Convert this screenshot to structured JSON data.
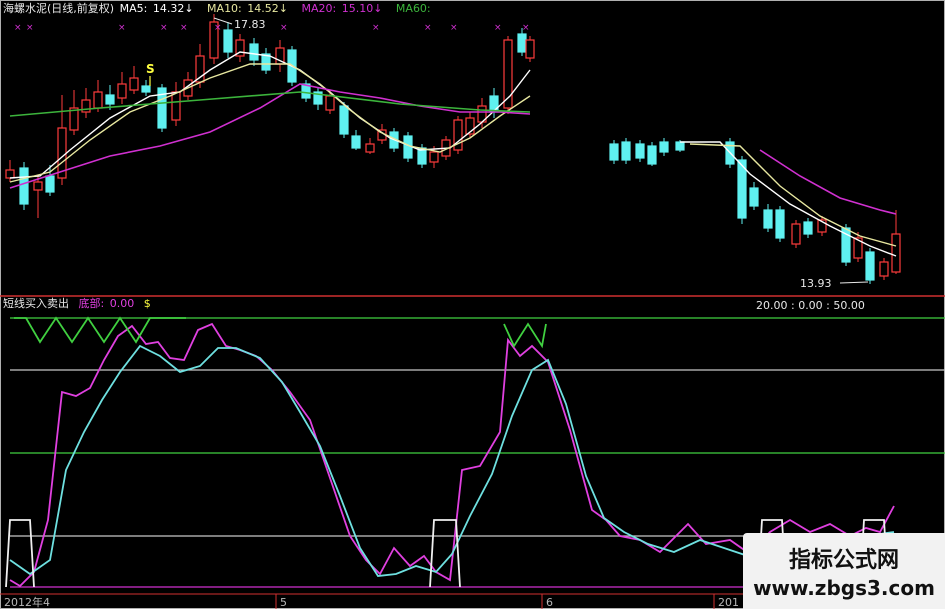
{
  "header": {
    "title": "海螺水泥(日线,前复权)",
    "ma5_label": "MA5:",
    "ma5_value": "14.32",
    "ma10_label": "MA10:",
    "ma10_value": "14.52",
    "ma20_label": "MA20:",
    "ma20_value": "15.10",
    "ma60_label": "MA60:",
    "arrow": "↓"
  },
  "annotations": {
    "high_price": "17.83",
    "low_price": "13.93",
    "signal_label": "S"
  },
  "indicator": {
    "title": "短线买入卖出",
    "bottom_label": "底部:",
    "bottom_value": "0.00",
    "extra_glyph": "$",
    "right_readout": "20.00 : 0.00 : 50.00"
  },
  "x_axis": {
    "labels": [
      "2012年4",
      "5",
      "6",
      "201"
    ]
  },
  "watermark": {
    "line1": "指标公式网",
    "line2_main": "www.zbgs3.com",
    "line2_highlight": "3"
  },
  "colors": {
    "background": "#000000",
    "up_candle": "#ff3c3c",
    "down_candle": "#5ff0f0",
    "ma5": "#ffffff",
    "ma10": "#e8e8a0",
    "ma20": "#d030d0",
    "ma60": "#3cb43c",
    "kline": "#e040e0",
    "dline": "#6ee0e0",
    "signal": "#40d040",
    "level": "#c8c8c8"
  }
}
